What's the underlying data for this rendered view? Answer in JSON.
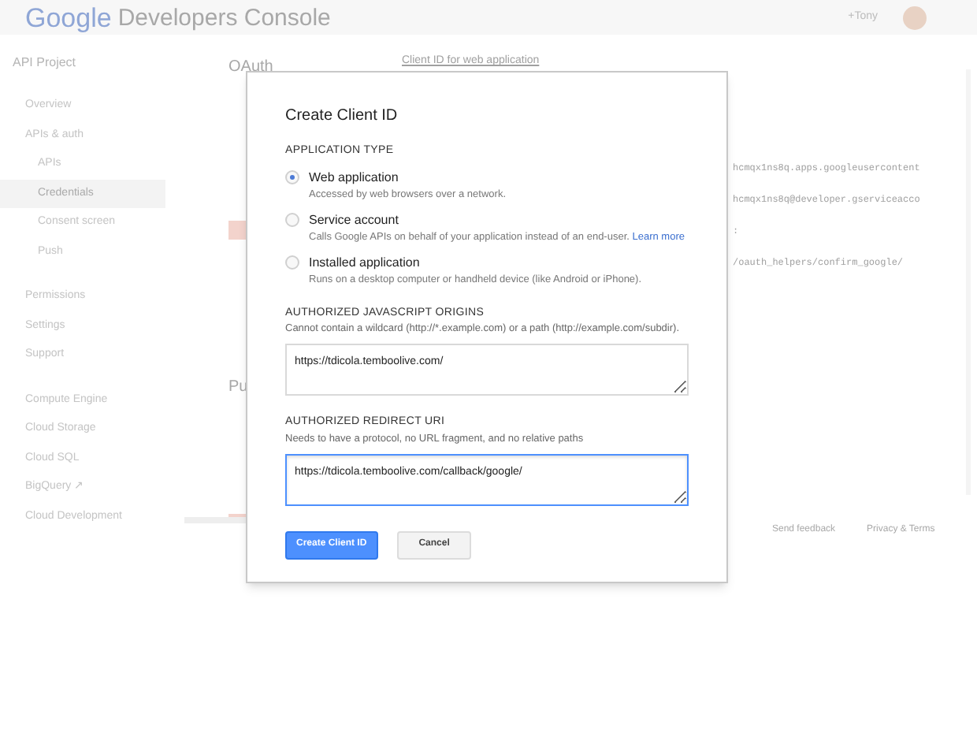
{
  "header": {
    "logo": "Google",
    "product": "Developers Console",
    "user": "+Tony"
  },
  "sidebar": {
    "back": "API Project",
    "items": [
      {
        "label": "Overview",
        "selected": false
      },
      {
        "label": "APIs & auth",
        "selected": false,
        "children": [
          {
            "label": "APIs",
            "selected": false
          },
          {
            "label": "Credentials",
            "selected": true
          },
          {
            "label": "Consent screen",
            "selected": false
          },
          {
            "label": "Push",
            "selected": false
          }
        ]
      },
      {
        "label": "Permissions",
        "selected": false
      },
      {
        "label": "Settings",
        "selected": false
      },
      {
        "label": "Support",
        "selected": false
      },
      {
        "label": "Compute Engine",
        "selected": false
      },
      {
        "label": "Cloud Storage",
        "selected": false
      },
      {
        "label": "Cloud SQL",
        "selected": false
      },
      {
        "label": "BigQuery ↗",
        "selected": false
      },
      {
        "label": "Cloud Development",
        "selected": false
      }
    ]
  },
  "main": {
    "section_title": "OAuth",
    "section_2_title": "Pu",
    "client_heading": "Client ID for web application",
    "code_lines": [
      "hcmqx1ns8q.apps.googleusercontent",
      "hcmqx1ns8q@developer.gserviceacco",
      ":",
      "/oauth_helpers/confirm_google/"
    ],
    "footer_links": [
      "Send feedback",
      "Privacy & Terms"
    ]
  },
  "dialog": {
    "title": "Create Client ID",
    "type_label": "APPLICATION TYPE",
    "options": [
      {
        "label": "Web application",
        "description": "Accessed by web browsers over a network.",
        "selected": true
      },
      {
        "label": "Service account",
        "description": "Calls Google APIs on behalf of your application instead of an end-user.",
        "link": "Learn more",
        "selected": false
      },
      {
        "label": "Installed application",
        "description": "Runs on a desktop computer or handheld device (like Android or iPhone).",
        "selected": false
      }
    ],
    "origins": {
      "label": "AUTHORIZED JAVASCRIPT ORIGINS",
      "hint": "Cannot contain a wildcard (http://*.example.com) or a path (http://example.com/subdir).",
      "value": "https://tdicola.temboolive.com/",
      "focused": false
    },
    "redirect": {
      "label": "AUTHORIZED REDIRECT URI",
      "hint": "Needs to have a protocol, no URL fragment, and no relative paths",
      "value": "https://tdicola.temboolive.com/callback/google/",
      "focused": true
    },
    "buttons": [
      "Create Client ID",
      "Cancel"
    ]
  }
}
